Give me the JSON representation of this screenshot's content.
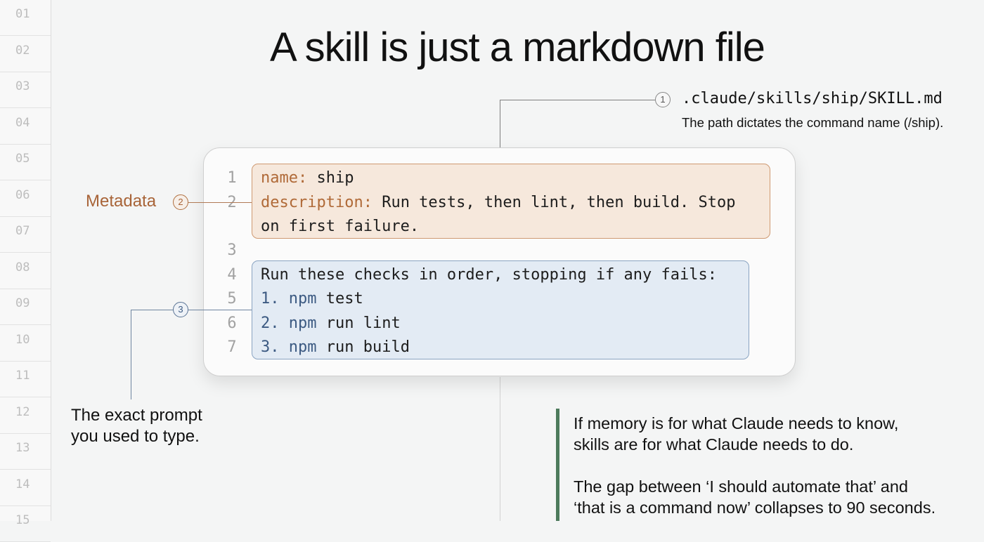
{
  "gutter": {
    "rows": [
      "01",
      "02",
      "03",
      "04",
      "05",
      "06",
      "07",
      "08",
      "09",
      "10",
      "11",
      "12",
      "13",
      "14",
      "15"
    ]
  },
  "title": "A skill is just a markdown file",
  "callouts": {
    "path": {
      "number": "1",
      "path": ".claude/skills/ship/SKILL.md",
      "description": "The path dictates the command name (/ship)."
    },
    "metadata": {
      "number": "2",
      "label": "Metadata"
    },
    "prompt": {
      "number": "3",
      "caption_line1": "The exact prompt",
      "caption_line2": "you used to type."
    }
  },
  "code": {
    "line_numbers": [
      "1",
      "2",
      "3",
      "4",
      "5",
      "6",
      "7"
    ],
    "name_key": "name:",
    "name_value": " ship",
    "description_key": "description:",
    "description_value": " Run tests, then lint, then build. Stop",
    "description_wrap": "on first failure.",
    "body_intro": "Run these checks in order, stopping if any fails:",
    "steps": [
      {
        "prefix": "1. npm",
        "rest": " test"
      },
      {
        "prefix": "2. npm",
        "rest": " run lint"
      },
      {
        "prefix": "3. npm",
        "rest": " run build"
      }
    ]
  },
  "quote": {
    "line1": "If memory is for what Claude needs to know,",
    "line2": "skills are for what Claude needs to do.",
    "line3": "The gap between ‘I should automate that’ and",
    "line4": "‘that is a command now’ collapses to 90 seconds."
  },
  "colors": {
    "metadata_accent": "#a86438",
    "metadata_fill": "#f6e8dc",
    "prompt_fill": "#e3ebf4",
    "prompt_accent": "#3c5a82",
    "quote_bar": "#4d7a5c"
  }
}
